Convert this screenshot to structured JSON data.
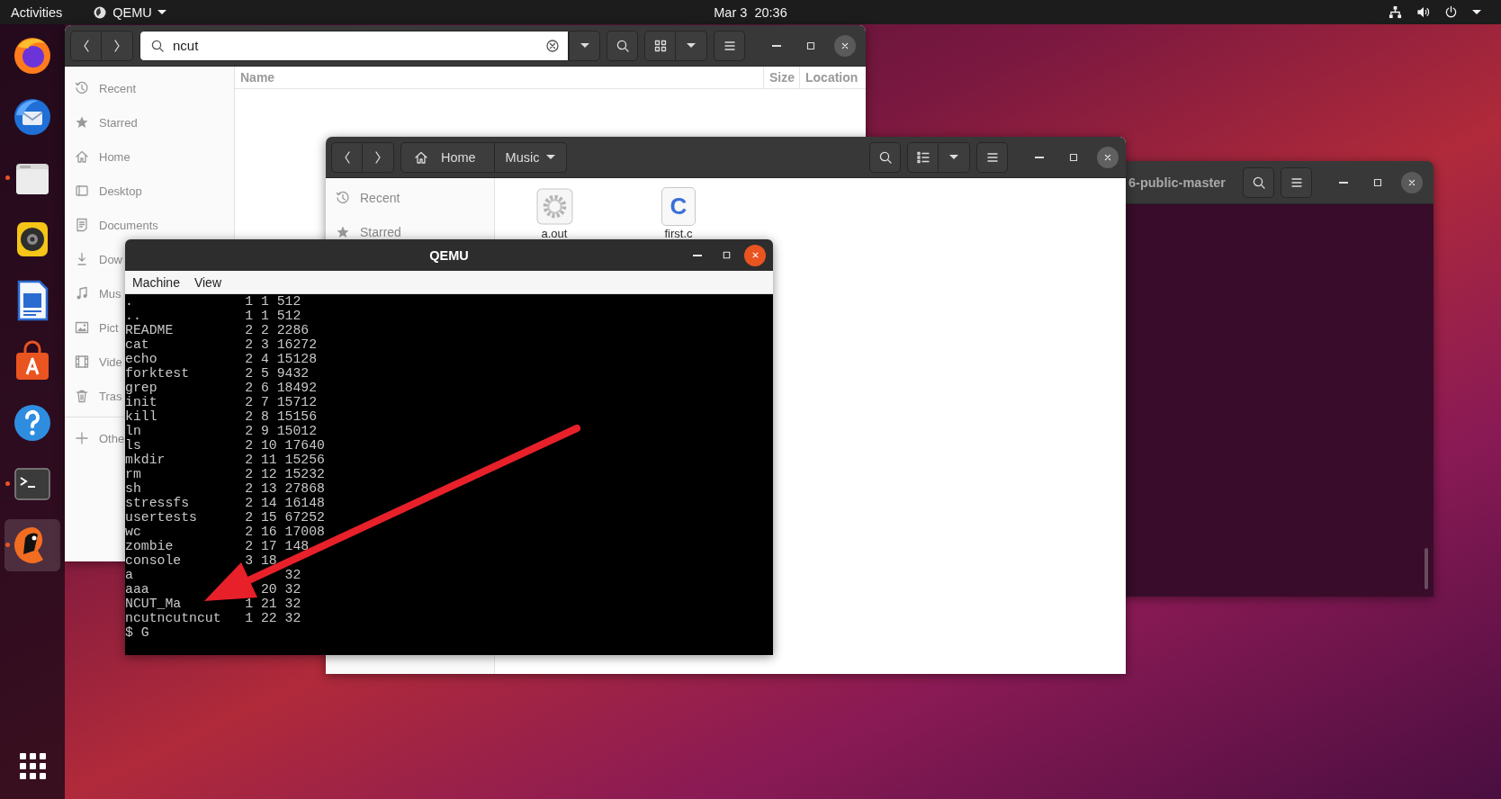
{
  "top_bar": {
    "activities": "Activities",
    "app_menu": "QEMU",
    "clock": "Mar 3  20:36"
  },
  "dock": {
    "items": [
      {
        "kind": "browser",
        "running": false,
        "selected": false
      },
      {
        "kind": "mail",
        "running": false,
        "selected": false
      },
      {
        "kind": "files",
        "running": true,
        "selected": false
      },
      {
        "kind": "music",
        "running": false,
        "selected": false
      },
      {
        "kind": "writer",
        "running": false,
        "selected": false
      },
      {
        "kind": "software",
        "running": false,
        "selected": false
      },
      {
        "kind": "help",
        "running": false,
        "selected": false
      },
      {
        "kind": "terminal",
        "running": true,
        "selected": false
      },
      {
        "kind": "qemu",
        "running": true,
        "selected": true
      }
    ]
  },
  "search_window": {
    "search": {
      "value": "ncut"
    },
    "sidebar": [
      {
        "kind": "recent",
        "label": "Recent"
      },
      {
        "kind": "starred",
        "label": "Starred"
      },
      {
        "kind": "home",
        "label": "Home"
      },
      {
        "kind": "desktop",
        "label": "Desktop"
      },
      {
        "kind": "documents",
        "label": "Documents"
      },
      {
        "kind": "downloads",
        "label": "Dow"
      },
      {
        "kind": "music",
        "label": "Mus"
      },
      {
        "kind": "pictures",
        "label": "Pict"
      },
      {
        "kind": "videos",
        "label": "Vide"
      },
      {
        "kind": "trash",
        "label": "Tras"
      }
    ],
    "other_locations": "Othe",
    "columns": [
      "Name",
      "Size",
      "Location"
    ]
  },
  "terminal_window": {
    "title": "6-public-master"
  },
  "music_window": {
    "path": [
      "Home",
      "Music"
    ],
    "sidebar": [
      {
        "kind": "recent",
        "label": "Recent"
      },
      {
        "kind": "starred",
        "label": "Starred"
      }
    ],
    "files": [
      {
        "kind": "binary",
        "name": "a.out"
      },
      {
        "kind": "source",
        "name": "first.c",
        "letter": "C"
      }
    ]
  },
  "qemu_window": {
    "title": "QEMU",
    "menu": [
      "Machine",
      "View"
    ],
    "lines": [
      ".              1 1 512",
      "..             1 1 512",
      "README         2 2 2286",
      "cat            2 3 16272",
      "echo           2 4 15128",
      "forktest       2 5 9432",
      "grep           2 6 18492",
      "init           2 7 15712",
      "kill           2 8 15156",
      "ln             2 9 15012",
      "ls             2 10 17640",
      "mkdir          2 11 15256",
      "rm             2 12 15232",
      "sh             2 13 27868",
      "stressfs       2 14 16148",
      "usertests      2 15 67252",
      "wc             2 16 17008",
      "zombie         2 17 148",
      "console        3 18",
      "a                   32",
      "aaa              20 32",
      "NCUT_Ma        1 21 32",
      "ncutncutncut   1 22 32",
      "$ G"
    ]
  },
  "annotation": {
    "kind": "arrow"
  }
}
